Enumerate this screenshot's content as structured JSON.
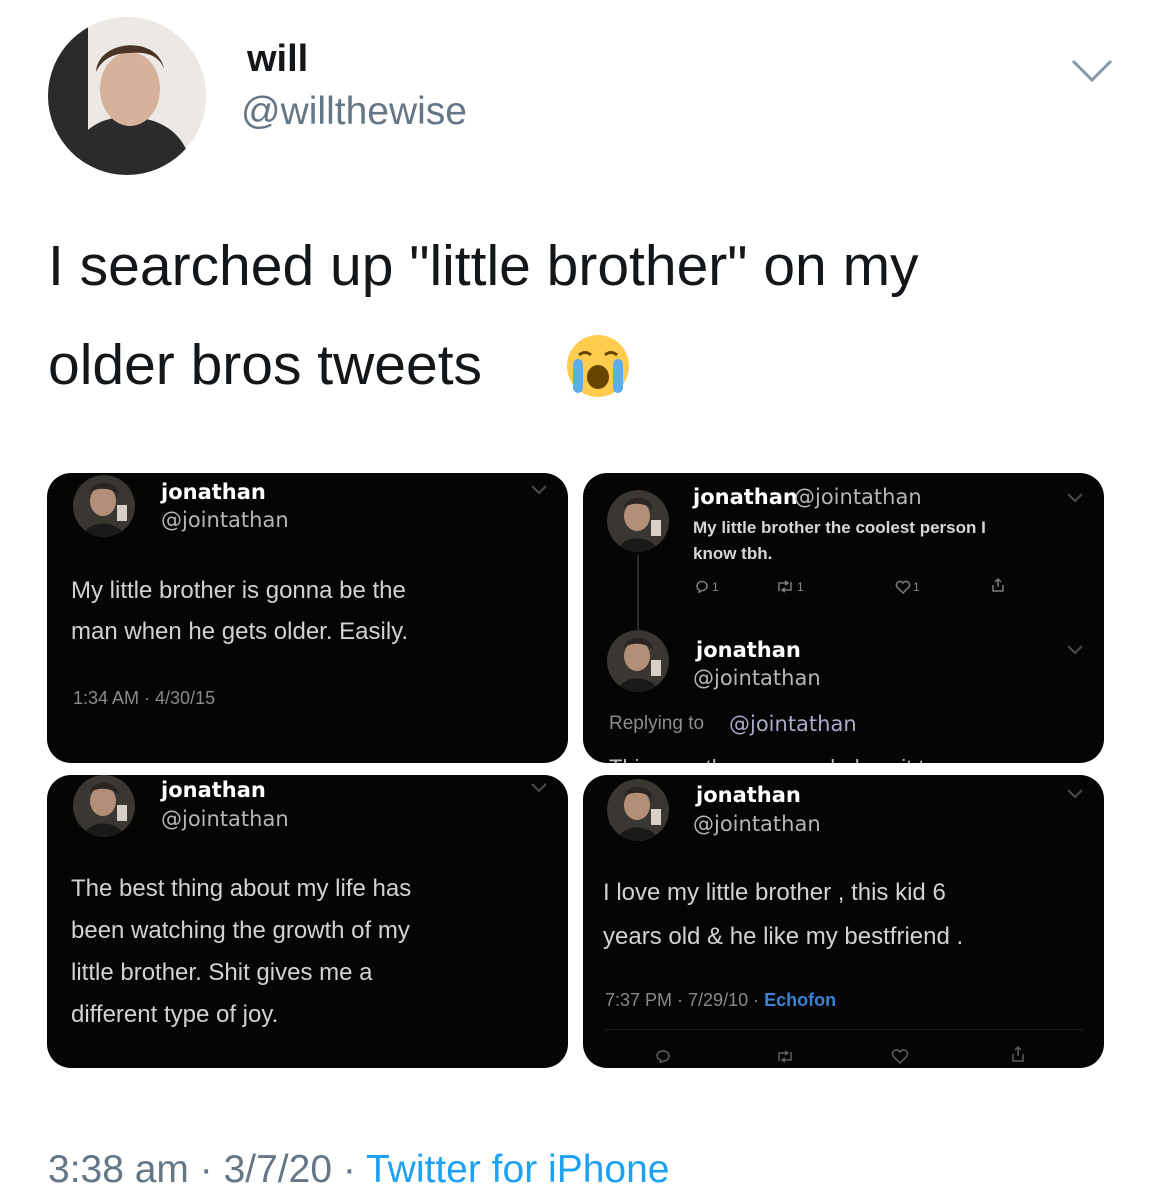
{
  "author": {
    "display_name": "will",
    "handle": "@willthewise"
  },
  "tweet": {
    "text_line1": "I searched up \"little brother\" on my",
    "text_line2": "older bros tweets",
    "emoji": "loudly-crying-face"
  },
  "panels": [
    {
      "name": "jonathan",
      "handle": "@jointathan",
      "lines": [
        "My little brother is gonna be the",
        "man when he gets older. Easily."
      ],
      "meta": "1:34 AM · 4/30/15"
    },
    {
      "name": "jonathan",
      "inline_handle": "@jointathan",
      "lines": [
        "My little brother the coolest person I",
        "know tbh."
      ],
      "counts": {
        "reply": "1",
        "retweet": "1",
        "like": "1"
      },
      "reply": {
        "name": "jonathan",
        "handle": "@jointathan",
        "replying_label": "Replying to",
        "replying_handle": "@jointathan",
        "cut_text": "This man threw on a whole suit to"
      }
    },
    {
      "name": "jonathan",
      "handle": "@jointathan",
      "lines": [
        "The best thing about my life has",
        "been watching the growth of my",
        "little brother. Shit gives me a",
        "different type of joy."
      ]
    },
    {
      "name": "jonathan",
      "handle": "@jointathan",
      "lines": [
        "I love my little brother , this kid 6",
        "years old & he like my bestfriend ."
      ],
      "meta": "7:37 PM · 7/29/10 · ",
      "source": "Echofon"
    }
  ],
  "footer": {
    "time": "3:38 am",
    "date": "3/7/20",
    "separator": " · ",
    "source": "Twitter for iPhone"
  },
  "colors": {
    "link": "#1da1f2",
    "muted": "#657786",
    "panel_bg": "#050505"
  }
}
